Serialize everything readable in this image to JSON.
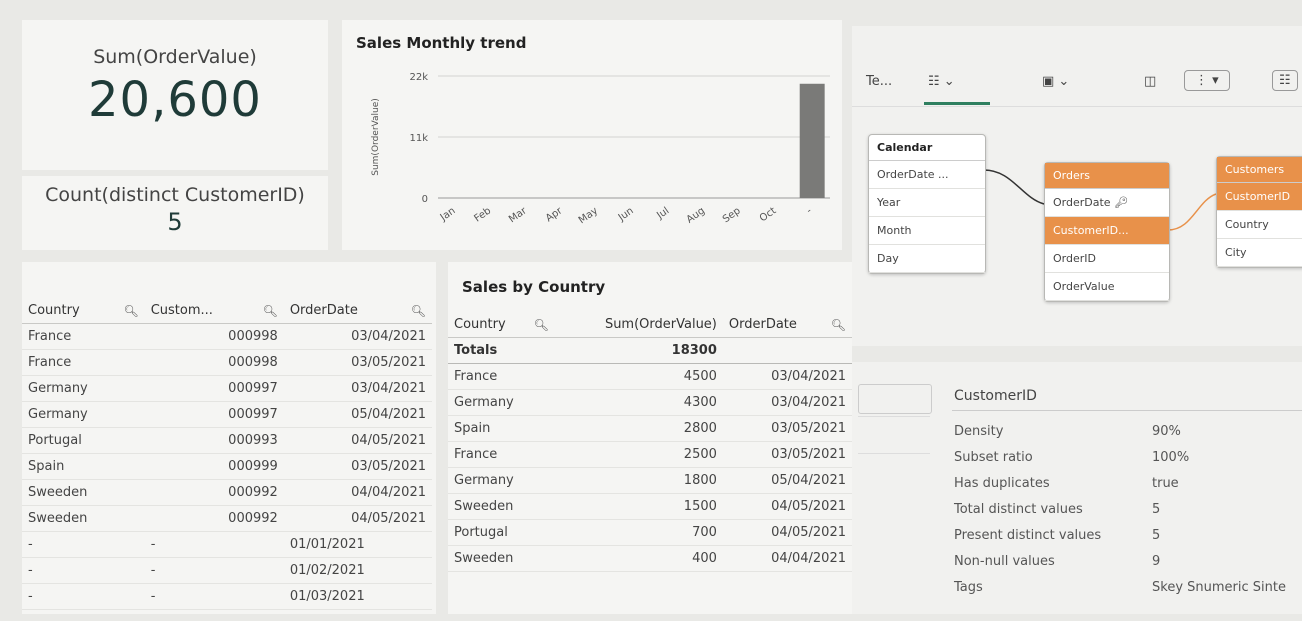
{
  "kpi": [
    {
      "label": "Sum(OrderValue)",
      "value": "20,600"
    },
    {
      "label": "Count(distinct CustomerID)",
      "value": "5"
    }
  ],
  "chart": {
    "title": "Sales Monthly trend",
    "ylabel": "Sum(OrderValue)"
  },
  "chart_data": {
    "type": "bar",
    "title": "Sales Monthly trend",
    "xlabel": "",
    "ylabel": "Sum(OrderValue)",
    "categories": [
      "Jan",
      "Feb",
      "Mar",
      "Apr",
      "May",
      "Jun",
      "Jul",
      "Aug",
      "Sep",
      "Oct",
      "-"
    ],
    "values": [
      0,
      0,
      0,
      0,
      0,
      0,
      0,
      0,
      0,
      0,
      20600
    ],
    "yticks": [
      "0",
      "11k",
      "22k"
    ],
    "ylim": [
      0,
      22000
    ],
    "grid": true,
    "bar_color": "#7a7a78"
  },
  "left_table": {
    "headers": [
      "Country",
      "Custom...",
      "OrderDate"
    ],
    "rows": [
      [
        "France",
        "000998",
        "03/04/2021"
      ],
      [
        "France",
        "000998",
        "03/05/2021"
      ],
      [
        "Germany",
        "000997",
        "03/04/2021"
      ],
      [
        "Germany",
        "000997",
        "05/04/2021"
      ],
      [
        "Portugal",
        "000993",
        "04/05/2021"
      ],
      [
        "Spain",
        "000999",
        "03/05/2021"
      ],
      [
        "Sweeden",
        "000992",
        "04/04/2021"
      ],
      [
        "Sweeden",
        "000992",
        "04/05/2021"
      ],
      [
        "-",
        "-",
        "01/01/2021"
      ],
      [
        "-",
        "-",
        "01/02/2021"
      ],
      [
        "-",
        "-",
        "01/03/2021"
      ]
    ]
  },
  "country_table": {
    "title": "Sales by Country",
    "headers": [
      "Country",
      "Sum(OrderValue)",
      "OrderDate"
    ],
    "totals_label": "Totals",
    "totals_value": "18300",
    "rows": [
      [
        "France",
        "4500",
        "03/04/2021"
      ],
      [
        "Germany",
        "4300",
        "03/04/2021"
      ],
      [
        "Spain",
        "2800",
        "03/05/2021"
      ],
      [
        "France",
        "2500",
        "03/05/2021"
      ],
      [
        "Germany",
        "1800",
        "05/04/2021"
      ],
      [
        "Sweeden",
        "1500",
        "04/05/2021"
      ],
      [
        "Portugal",
        "700",
        "04/05/2021"
      ],
      [
        "Sweeden",
        "400",
        "04/04/2021"
      ]
    ]
  },
  "model": {
    "toolbar_label": "Te...",
    "calendar": {
      "name": "Calendar",
      "fields": [
        "OrderDate ...",
        "Year",
        "Month",
        "Day"
      ]
    },
    "orders": {
      "name": "Orders",
      "fields": [
        "OrderDate",
        "CustomerID...",
        "OrderID",
        "OrderValue"
      ]
    },
    "customers": {
      "name": "Customers",
      "fields": [
        "CustomerID",
        "Country",
        "City"
      ]
    }
  },
  "details": {
    "field": "CustomerID",
    "rows": [
      {
        "label": "Density",
        "value": "90%"
      },
      {
        "label": "Subset ratio",
        "value": "100%"
      },
      {
        "label": "Has duplicates",
        "value": "true"
      },
      {
        "label": "Total distinct values",
        "value": "5"
      },
      {
        "label": "Present distinct values",
        "value": "5"
      },
      {
        "label": "Non-null values",
        "value": "9"
      },
      {
        "label": "Tags",
        "value": "Skey Snumeric Sinte"
      }
    ]
  }
}
